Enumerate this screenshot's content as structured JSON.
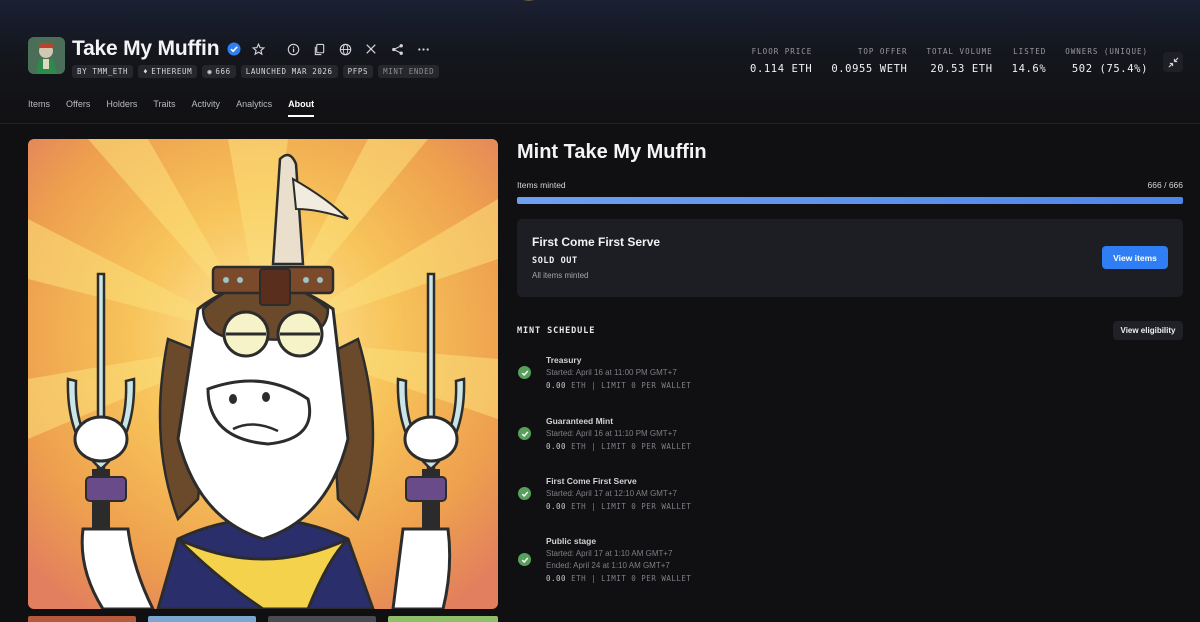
{
  "collection": {
    "name": "Take My Muffin",
    "verified_icon": "verified-badge-icon",
    "badges": {
      "creator": "BY TMM_ETH",
      "chain": "ETHEREUM",
      "items": "666",
      "launched": "LAUNCHED MAR 2026",
      "category": "PFPS",
      "status": "MINT ENDED"
    }
  },
  "header_icons": [
    "star-icon",
    "info-icon",
    "copy-icon",
    "globe-icon",
    "x-icon",
    "share-icon",
    "more-icon"
  ],
  "stats": [
    {
      "label": "FLOOR PRICE",
      "value": "0.114 ETH"
    },
    {
      "label": "TOP OFFER",
      "value": "0.0955 WETH"
    },
    {
      "label": "TOTAL VOLUME",
      "value": "20.53 ETH"
    },
    {
      "label": "LISTED",
      "value": "14.6%"
    },
    {
      "label": "OWNERS (UNIQUE)",
      "value": "502 (75.4%)"
    }
  ],
  "tabs": [
    "Items",
    "Offers",
    "Holders",
    "Traits",
    "Activity",
    "Analytics",
    "About"
  ],
  "active_tab": "About",
  "mint": {
    "title": "Mint Take My Muffin",
    "minted_label": "Items minted",
    "minted_count": "666 / 666",
    "progress_fraction": 1.0,
    "card": {
      "title": "First Come First Serve",
      "status": "SOLD OUT",
      "subtitle": "All items minted",
      "button": "View items"
    },
    "schedule_heading": "MINT SCHEDULE",
    "eligibility_button": "View eligibility",
    "stages": [
      {
        "name": "Treasury",
        "lines": [
          "Started: April 16 at 11:00 PM GMT+7"
        ],
        "price": "0.00",
        "meta": "ETH | LIMIT 0 PER WALLET"
      },
      {
        "name": "Guaranteed Mint",
        "lines": [
          "Started: April 16 at 11:10 PM GMT+7"
        ],
        "price": "0.00",
        "meta": "ETH | LIMIT 0 PER WALLET"
      },
      {
        "name": "First Come First Serve",
        "lines": [
          "Started: April 17 at 12:10 AM GMT+7"
        ],
        "price": "0.00",
        "meta": "ETH | LIMIT 0 PER WALLET"
      },
      {
        "name": "Public stage",
        "lines": [
          "Started: April 17 at 1:10 AM GMT+7",
          "Ended: April 24 at 1:10 AM GMT+7"
        ],
        "price": "0.00",
        "meta": "ETH | LIMIT 0 PER WALLET"
      }
    ]
  },
  "colors": {
    "accent": "#2f7ef3",
    "check": "#57a05c",
    "progress": "#5a90ec"
  }
}
